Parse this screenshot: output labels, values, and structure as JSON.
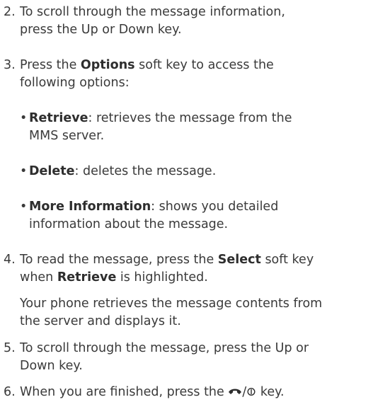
{
  "steps": [
    {
      "number": "2.",
      "lines": [
        "To scroll through the message information,",
        "press the Up or Down key."
      ]
    },
    {
      "number": "3.",
      "pre": "Press the ",
      "bold": "Options",
      "post": " soft key to access the",
      "line2": "following options:"
    },
    {
      "number": "4.",
      "pre": "To read the message, press the ",
      "bold": "Select",
      "post": " soft key",
      "line2_bold": "when ",
      "line2_term": "Retrieve",
      "line2_post": " is highlighted."
    },
    {
      "number": "5.",
      "lines": [
        "To scroll through the message, press the Up or",
        "Down key."
      ]
    },
    {
      "number": "6.",
      "pre": "When you are finished, press the ",
      "key_icon": "end-power-key-icon",
      "key_glyph": "/",
      "post": " key."
    }
  ],
  "options": [
    {
      "term": "Retrieve",
      "desc": ": retrieves the message from the",
      "desc2": "MMS server."
    },
    {
      "term": "Delete",
      "desc": ": deletes the message.",
      "desc2": ""
    },
    {
      "term": "More Information",
      "desc": ": shows you detailed",
      "desc2": "information about the message."
    }
  ],
  "bullet_char": "•",
  "step4_note": [
    "Your phone retrieves the message contents from",
    "the server and displays it."
  ]
}
